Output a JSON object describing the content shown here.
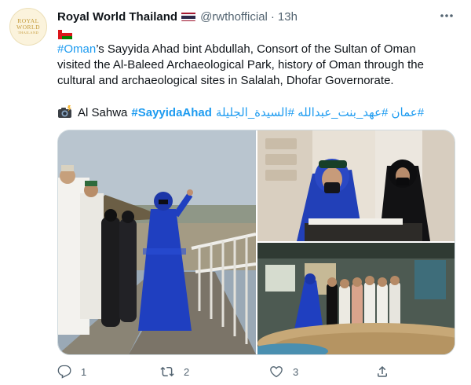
{
  "tweet": {
    "avatar": {
      "line1": "ROYAL",
      "line2": "WORLD",
      "line3": "THAILAND"
    },
    "display_name": "Royal World Thailand",
    "handle": "@rwthofficial",
    "separator": "·",
    "time": "13h",
    "text": {
      "hashtag_oman": "#Oman",
      "body": "’s Sayyida Ahad bint Abdullah, Consort of the Sultan of Oman visited the Al-Baleed Archaeological Park, history of Oman through the cultural and archaeological sites in Salalah, Dhofar Governorate."
    },
    "credit": {
      "source": "Al Sahwa",
      "hashtag_sayyida": "#SayyidaAhad",
      "hashtag_arabic": "#عمان #عهد_بنت_عبدالله #السيدة_الجليلة"
    },
    "actions": {
      "replies": "1",
      "retweets": "2",
      "likes": "3"
    }
  },
  "icons": {
    "thai_flag": "thailand-flag-icon",
    "oman_flag": "oman-flag-icon",
    "camera": "camera-flash-icon",
    "more": "more-horizontal-icon",
    "reply": "reply-icon",
    "retweet": "retweet-icon",
    "like": "heart-icon",
    "share": "share-icon"
  },
  "colors": {
    "link": "#1d9bf0",
    "text": "#0f1419",
    "muted": "#536471",
    "border": "#cfd9de",
    "abaya_blue": "#1f3fc0"
  }
}
